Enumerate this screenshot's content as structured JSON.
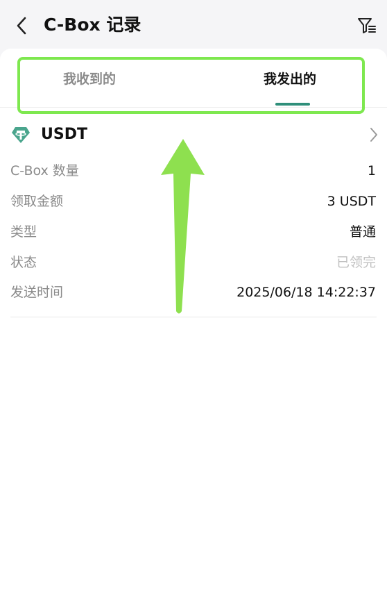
{
  "header": {
    "title": "C-Box 记录",
    "back_icon": "chevron-left-icon",
    "filter_icon": "filter-icon"
  },
  "tabs": [
    {
      "label": "我收到的",
      "active": false
    },
    {
      "label": "我发出的",
      "active": true
    }
  ],
  "record": {
    "coin": "USDT",
    "coin_icon": "tether-icon",
    "rows": [
      {
        "label": "C-Box 数量",
        "value": "1"
      },
      {
        "label": "领取金额",
        "value": "3 USDT"
      },
      {
        "label": "类型",
        "value": "普通"
      },
      {
        "label": "状态",
        "value": "已领完"
      },
      {
        "label": "发送时间",
        "value": "2025/06/18 14:22:37"
      }
    ]
  },
  "colors": {
    "accent": "#2f8f7a",
    "coin_icon": "#4aa58d",
    "annotation": "#7ee84f"
  }
}
